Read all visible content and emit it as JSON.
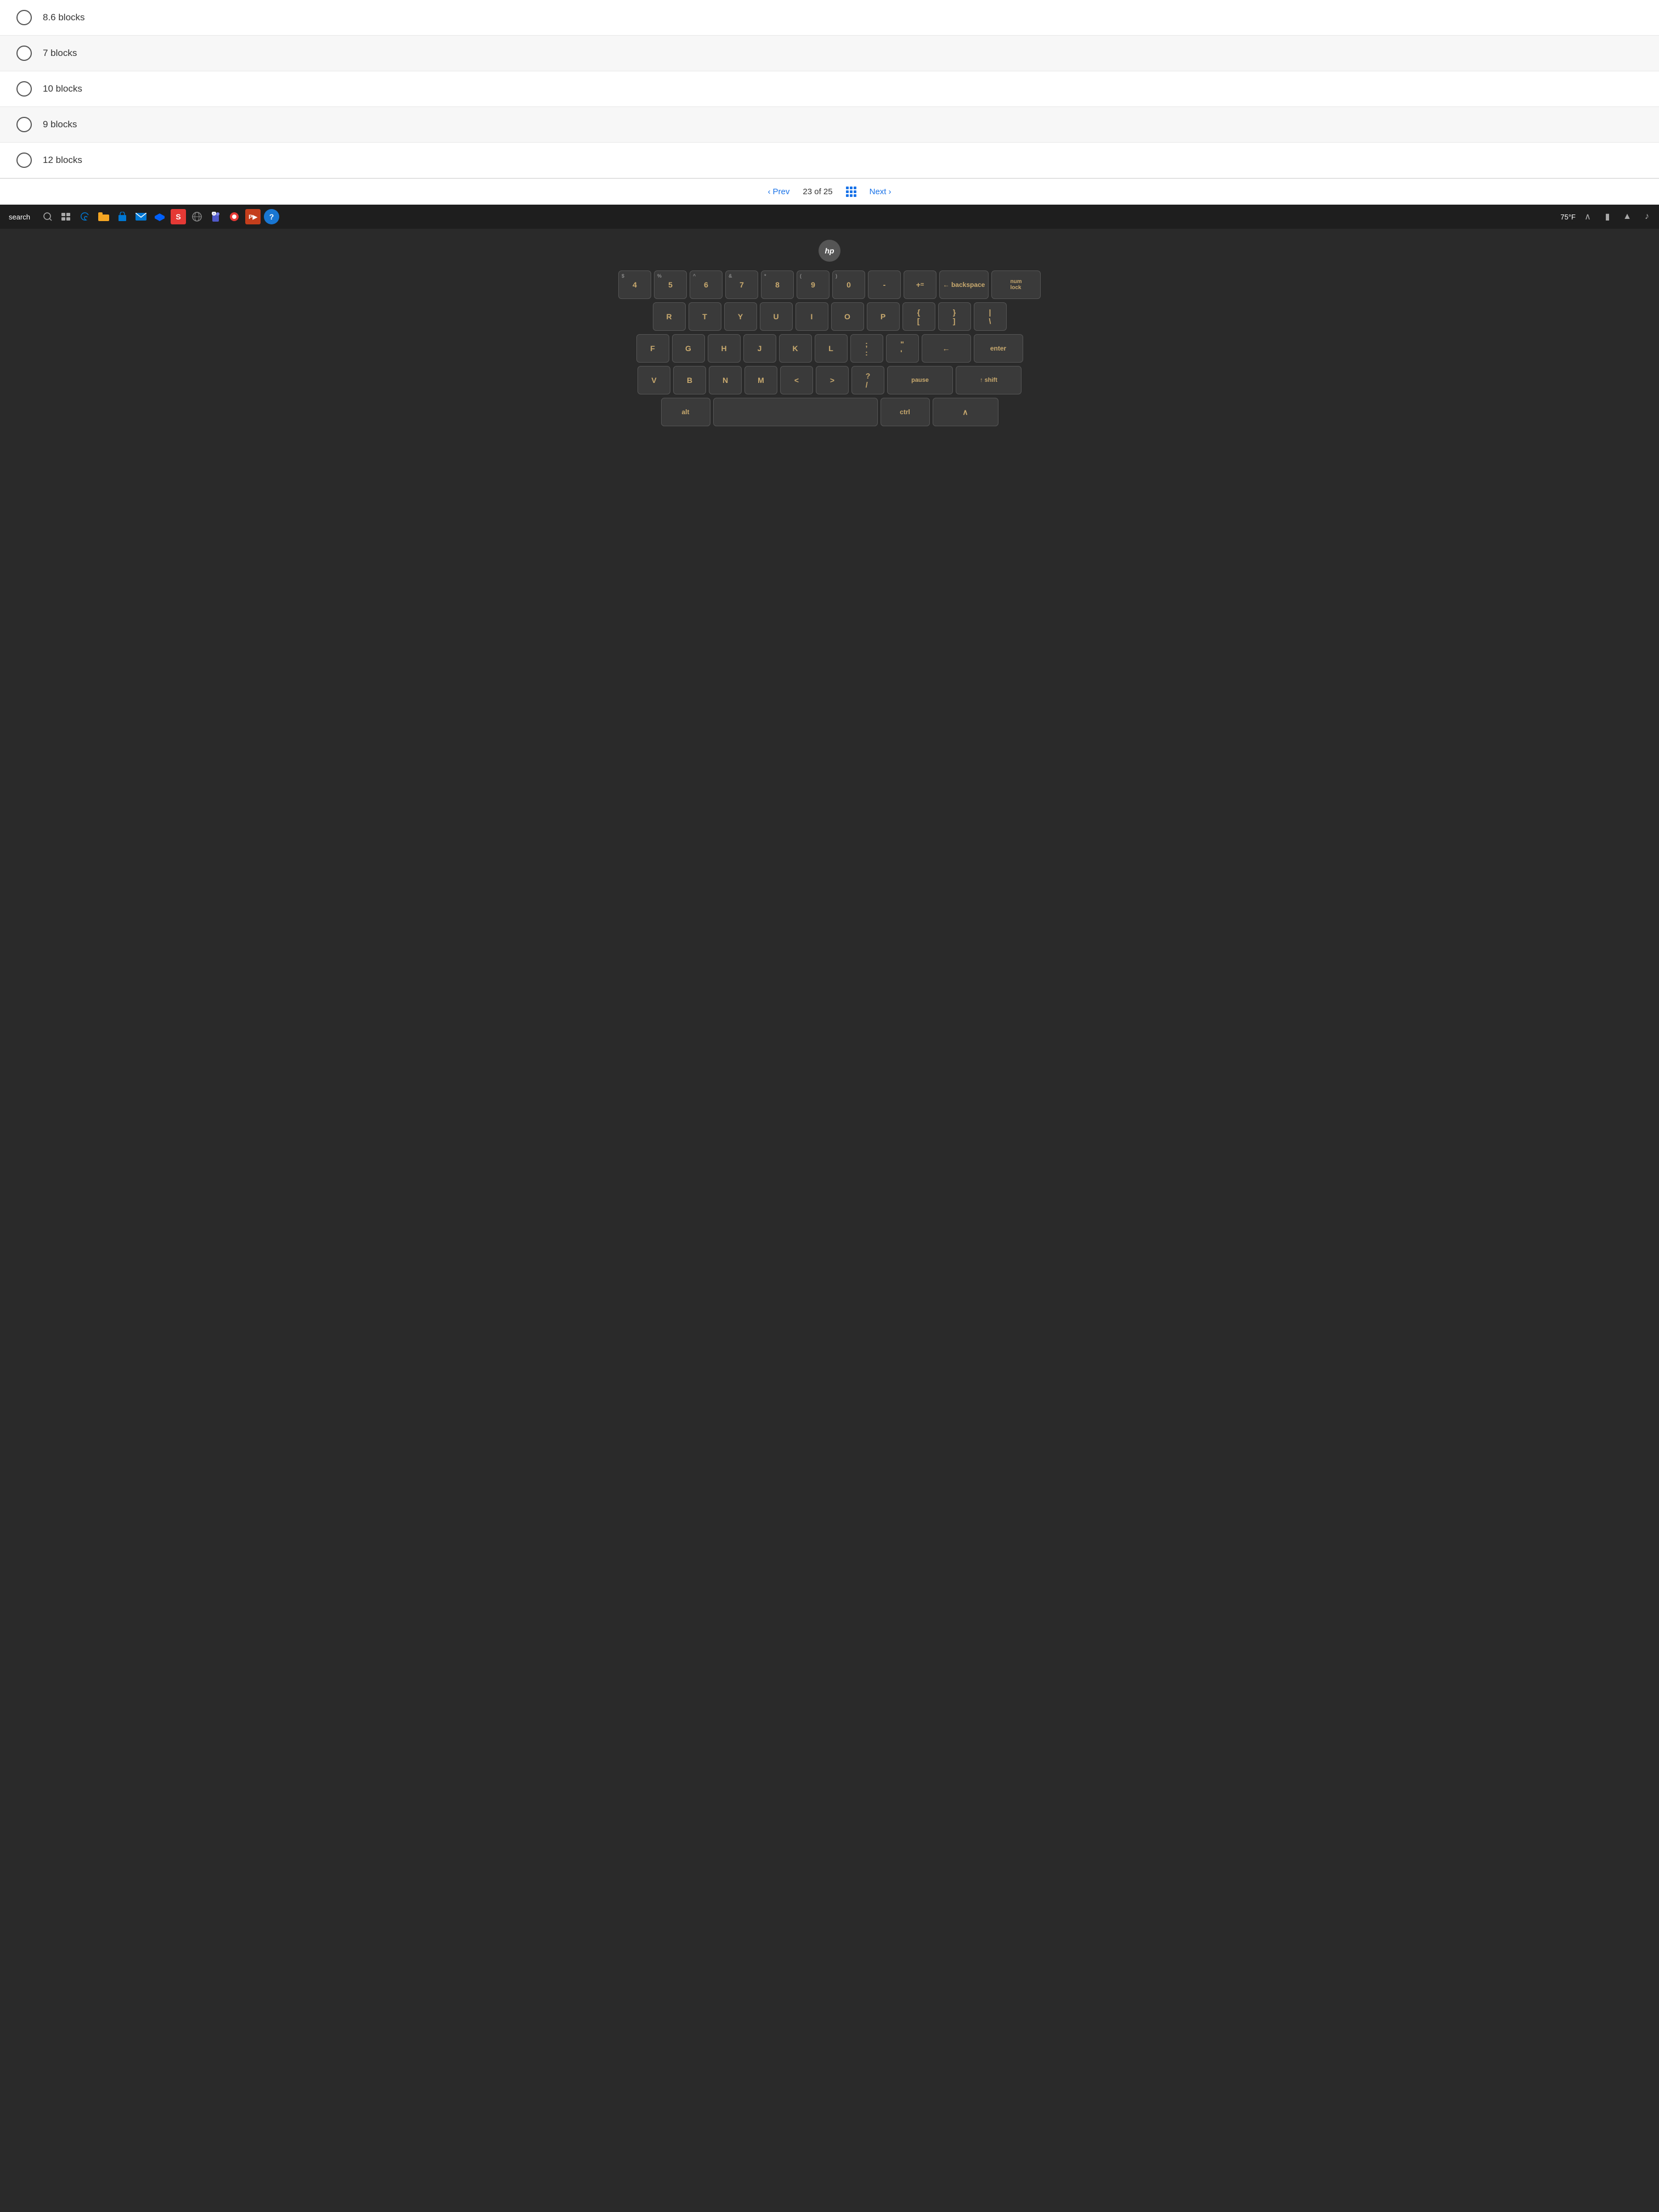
{
  "quiz": {
    "options": [
      {
        "id": "opt1",
        "label": "8.6 blocks"
      },
      {
        "id": "opt2",
        "label": "7 blocks"
      },
      {
        "id": "opt3",
        "label": "10 blocks"
      },
      {
        "id": "opt4",
        "label": "9 blocks"
      },
      {
        "id": "opt5",
        "label": "12 blocks"
      }
    ],
    "nav": {
      "prev_label": "Prev",
      "counter": "23 of 25",
      "next_label": "Next"
    }
  },
  "taskbar": {
    "search_label": "search",
    "temperature": "75°F"
  },
  "keyboard": {
    "hp_logo": "hp",
    "rows": [
      [
        "4",
        "5",
        "6",
        "7",
        "8",
        "9",
        "0",
        "-",
        "=",
        "←",
        "backspace",
        "num lock"
      ],
      [
        "R",
        "T",
        "Y",
        "U",
        "I",
        "O",
        "P",
        "[",
        "]",
        "\\"
      ],
      [
        "F",
        "G",
        "H",
        "J",
        "K",
        "L",
        ";",
        "'",
        "←",
        "enter"
      ],
      [
        "V",
        "B",
        "N",
        "M",
        "<",
        ">",
        "?",
        "/",
        "pause",
        "↑ shift"
      ]
    ]
  }
}
